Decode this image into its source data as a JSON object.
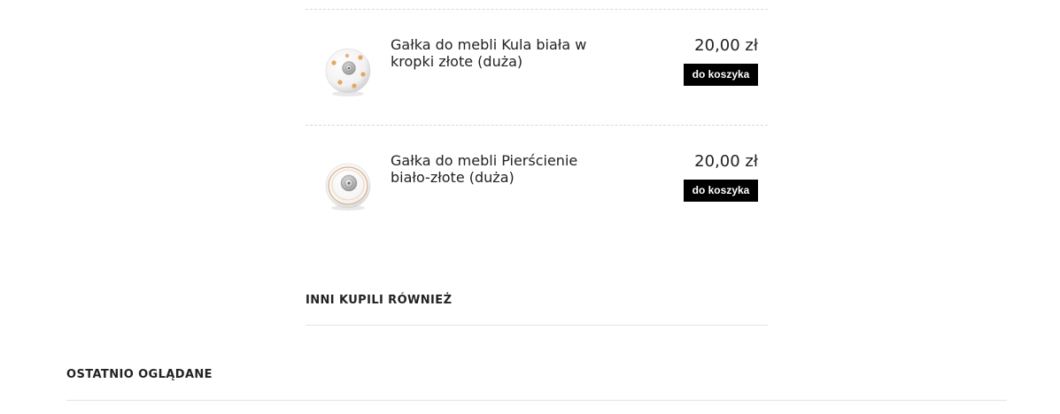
{
  "products": [
    {
      "name": "Gałka do mebli Kula biała w kropki złote (duża)",
      "price": "20,00 zł",
      "button_label": "do koszyka",
      "image": "knob-ball-white-gold-dots"
    },
    {
      "name": "Gałka do mebli Pierścienie biało-złote (duża)",
      "price": "20,00 zł",
      "button_label": "do koszyka",
      "image": "knob-rings-white-gold"
    }
  ],
  "sections": {
    "also_bought": "INNI KUPILI RÓWNIEŻ",
    "recently_viewed": "OSTATNIO OGLĄDANE"
  },
  "colors": {
    "button_bg": "#000000",
    "button_text": "#ffffff",
    "accent_gold": "#e0a55a"
  }
}
